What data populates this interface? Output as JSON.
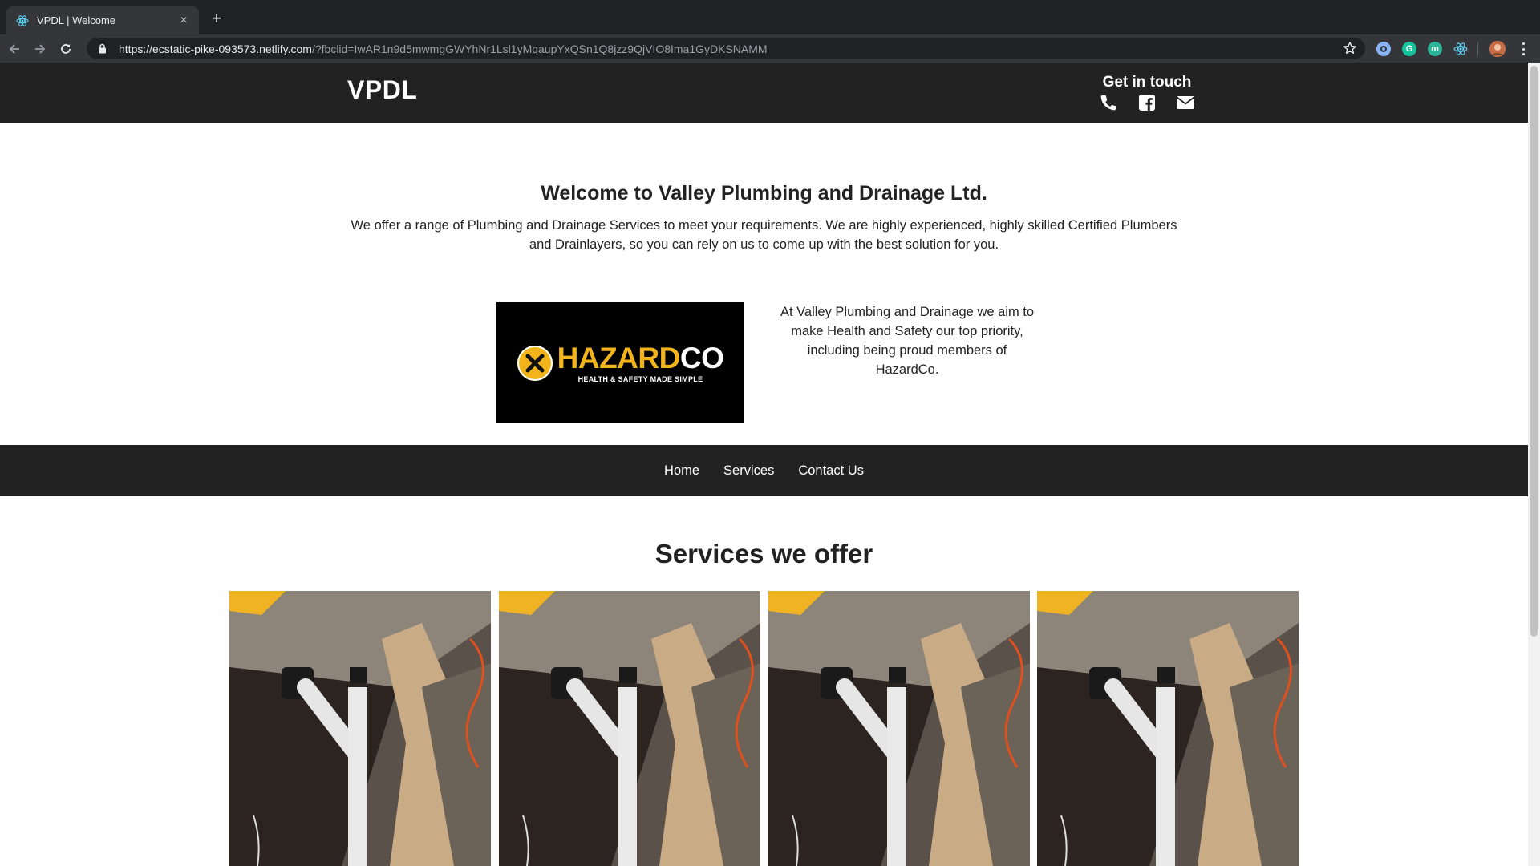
{
  "browser": {
    "tab_title": "VPDL | Welcome",
    "url_host": "https://ecstatic-pike-093573.netlify.com",
    "url_rest": "/?fbclid=IwAR1n9d5mwmgGWYhNr1Lsl1yMqaupYxQSn1Q8jzz9QjVIO8Ima1GyDKSNAMM",
    "new_tab_symbol": "+",
    "close_symbol": "×",
    "extensions": [
      "ext-blue-circle",
      "grammarly-icon",
      "mercury-icon",
      "react-icon",
      "profile-avatar"
    ]
  },
  "header": {
    "logo": "VPDL",
    "contact_title": "Get in touch",
    "contact_icons": [
      "phone-icon",
      "facebook-icon",
      "envelope-icon"
    ]
  },
  "welcome": {
    "title": "Welcome to Valley Plumbing and Drainage Ltd.",
    "text": "We offer a range of Plumbing and Drainage Services to meet your requirements. We are highly experienced, highly skilled Certified Plumbers and Drainlayers, so you can rely on us to come up with the best solution for you."
  },
  "hazardco": {
    "brand_part1": "HAZARD",
    "brand_part2": "CO",
    "tagline": "HEALTH & SAFETY MADE SIMPLE",
    "text": "At Valley Plumbing and Drainage we aim to make Health and Safety our top priority, including being proud members of HazardCo."
  },
  "nav": {
    "items": [
      "Home",
      "Services",
      "Contact Us"
    ]
  },
  "services": {
    "title": "Services we offer",
    "cards": [
      "pipe-photo",
      "pipe-photo",
      "pipe-photo",
      "pipe-photo"
    ]
  },
  "colors": {
    "header_bg": "#222222",
    "hazard_yellow": "#f3b41b",
    "chrome_dark": "#202124",
    "chrome_toolbar": "#35363a"
  }
}
